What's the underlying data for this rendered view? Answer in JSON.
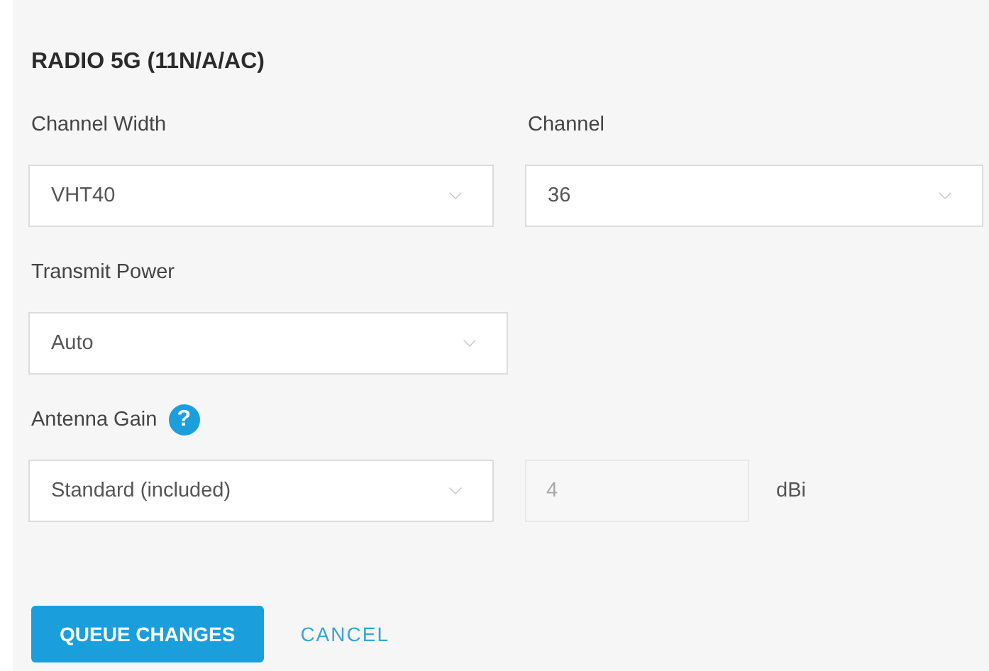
{
  "section_title": "RADIO 5G (11N/A/AC)",
  "rows": [
    {
      "fields": [
        {
          "label": "Channel Width",
          "kind": "select",
          "value": "VHT40"
        },
        {
          "label": "Channel",
          "kind": "select",
          "value": "36"
        }
      ]
    },
    {
      "fields": [
        {
          "label": "Transmit Power",
          "kind": "select",
          "value": "Auto"
        }
      ]
    },
    {
      "fields": [
        {
          "label": "Antenna Gain",
          "help": "?",
          "kind": "select",
          "value": "Standard (included)"
        },
        {
          "kind": "input",
          "value": "4",
          "disabled": true,
          "unit": "dBi"
        }
      ]
    }
  ],
  "buttons": [
    {
      "label": "QUEUE CHANGES",
      "kind": "primary"
    },
    {
      "label": "CANCEL",
      "kind": "link"
    }
  ]
}
